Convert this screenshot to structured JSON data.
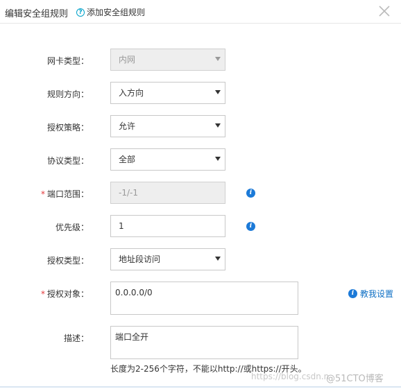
{
  "header": {
    "title": "编辑安全组规则",
    "help_icon": "question-circle-icon",
    "help_text": "添加安全组规则",
    "close_icon": "close-icon"
  },
  "form": {
    "nic_type": {
      "label": "网卡类型：",
      "value": "内网",
      "disabled": true
    },
    "direction": {
      "label": "规则方向：",
      "value": "入方向"
    },
    "policy": {
      "label": "授权策略：",
      "value": "允许"
    },
    "protocol": {
      "label": "协议类型：",
      "value": "全部"
    },
    "port_range": {
      "required_mark": "*",
      "label": "端口范围：",
      "value": "-1/-1",
      "disabled": true,
      "info_icon": "info-icon"
    },
    "priority": {
      "label": "优先级：",
      "value": "1",
      "info_icon": "info-icon"
    },
    "auth_type": {
      "label": "授权类型：",
      "value": "地址段访问"
    },
    "auth_object": {
      "required_mark": "*",
      "label": "授权对象：",
      "value": "0.0.0.0/0",
      "help_link": "教我设置",
      "help_icon": "info-icon"
    },
    "description": {
      "label": "描述：",
      "value": "端口全开",
      "hint": "长度为2-256个字符，不能以http://或https://开头。"
    }
  },
  "watermark": {
    "url": "https://blog.csdn.n",
    "brand": "@51CTO博客"
  },
  "colors": {
    "accent": "#1c7ad8",
    "link": "#0e6fc4",
    "required": "#e4393c",
    "help": "#00a2ca"
  }
}
